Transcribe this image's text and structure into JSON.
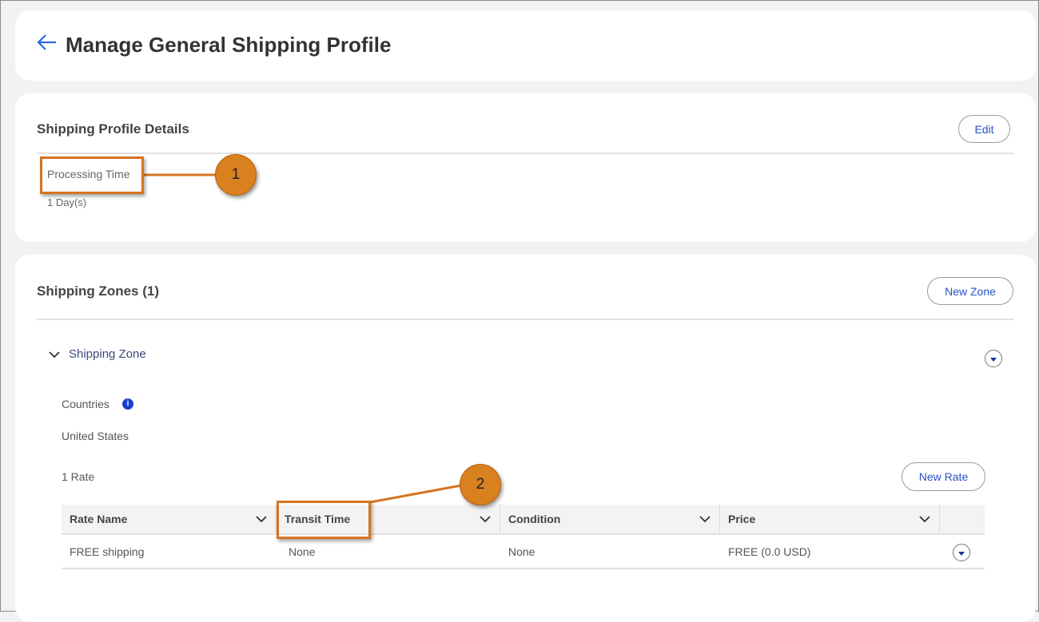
{
  "header": {
    "title": "Manage General Shipping Profile",
    "back_icon": "arrow-left-icon"
  },
  "details": {
    "title": "Shipping Profile Details",
    "edit_label": "Edit",
    "field_label": "Processing Time",
    "field_value": "1 Day(s)"
  },
  "zones": {
    "title": "Shipping Zones (1)",
    "new_zone_label": "New Zone",
    "zone_name": "Shipping Zone",
    "countries_label": "Countries",
    "countries_value": "United States",
    "rate_count": "1 Rate",
    "new_rate_label": "New Rate",
    "columns": [
      "Rate Name",
      "Transit Time",
      "Condition",
      "Price"
    ],
    "rows": [
      {
        "rate_name": "FREE shipping",
        "transit_time": "None",
        "condition": "None",
        "price": "FREE (0.0 USD)"
      }
    ]
  },
  "annotations": [
    "1",
    "2"
  ],
  "colors": {
    "accent": "#2a4fc7",
    "annotation": "#d9801f"
  }
}
